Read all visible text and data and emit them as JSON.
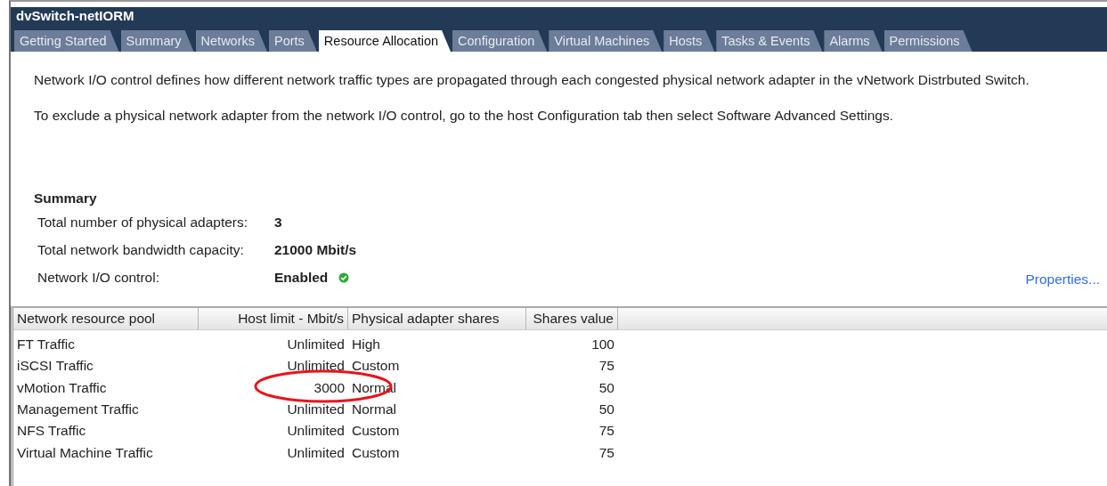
{
  "window": {
    "title": "dvSwitch-netIORM"
  },
  "tabs": [
    {
      "label": "Getting Started",
      "selected": false
    },
    {
      "label": "Summary",
      "selected": false
    },
    {
      "label": "Networks",
      "selected": false
    },
    {
      "label": "Ports",
      "selected": false
    },
    {
      "label": "Resource Allocation",
      "selected": true
    },
    {
      "label": "Configuration",
      "selected": false
    },
    {
      "label": "Virtual Machines",
      "selected": false
    },
    {
      "label": "Hosts",
      "selected": false
    },
    {
      "label": "Tasks & Events",
      "selected": false
    },
    {
      "label": "Alarms",
      "selected": false
    },
    {
      "label": "Permissions",
      "selected": false
    }
  ],
  "description": [
    "Network I/O control defines how different network traffic types are propagated through each congested physical network adapter in the vNetwork Distrbuted Switch.",
    "To exclude a physical network adapter from the network I/O control, go to the host Configuration tab then select Software Advanced Settings."
  ],
  "summary": {
    "title": "Summary",
    "rows": [
      {
        "label": "Total number of physical adapters:",
        "value": "3"
      },
      {
        "label": "Total network bandwidth capacity:",
        "value": "21000 Mbit/s"
      },
      {
        "label": "Network I/O control:",
        "value": "Enabled",
        "status_ok": true
      }
    ]
  },
  "properties_link": "Properties...",
  "table": {
    "columns": [
      "Network resource pool",
      "Host limit - Mbit/s",
      "Physical adapter shares",
      "Shares value"
    ],
    "rows": [
      {
        "pool": "FT Traffic",
        "limit": "Unlimited",
        "shares": "High",
        "value": "100",
        "circled": false
      },
      {
        "pool": "iSCSI Traffic",
        "limit": "Unlimited",
        "shares": "Custom",
        "value": "75",
        "circled": false
      },
      {
        "pool": "vMotion Traffic",
        "limit": "3000",
        "shares": "Normal",
        "value": "50",
        "circled": true
      },
      {
        "pool": "Management Traffic",
        "limit": "Unlimited",
        "shares": "Normal",
        "value": "50",
        "circled": false
      },
      {
        "pool": "NFS Traffic",
        "limit": "Unlimited",
        "shares": "Custom",
        "value": "75",
        "circled": false
      },
      {
        "pool": "Virtual Machine Traffic",
        "limit": "Unlimited",
        "shares": "Custom",
        "value": "75",
        "circled": false
      }
    ]
  }
}
